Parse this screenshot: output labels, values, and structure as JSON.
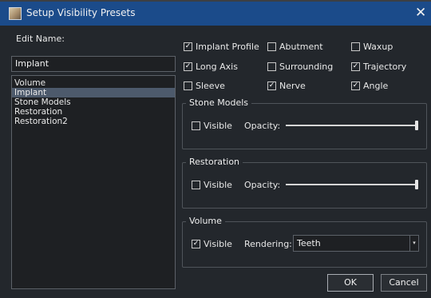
{
  "window": {
    "title": "Setup Visibility Presets"
  },
  "edit_name": {
    "label": "Edit Name:",
    "value": "Implant"
  },
  "presets": [
    "Volume",
    "Implant",
    "Stone Models",
    "Restoration",
    "Restoration2"
  ],
  "selected_preset": "Implant",
  "options": [
    {
      "label": "Implant Profile",
      "checked": true
    },
    {
      "label": "Abutment",
      "checked": false
    },
    {
      "label": "Waxup",
      "checked": false
    },
    {
      "label": "Long Axis",
      "checked": true
    },
    {
      "label": "Surrounding",
      "checked": false
    },
    {
      "label": "Trajectory",
      "checked": true
    },
    {
      "label": "Sleeve",
      "checked": false
    },
    {
      "label": "Nerve",
      "checked": true
    },
    {
      "label": "Angle",
      "checked": true
    }
  ],
  "stone_models": {
    "title": "Stone Models",
    "visible_label": "Visible",
    "visible_checked": false,
    "opacity_label": "Opacity:",
    "opacity": 1.0
  },
  "restoration": {
    "title": "Restoration",
    "visible_label": "Visible",
    "visible_checked": false,
    "opacity_label": "Opacity:",
    "opacity": 1.0
  },
  "volume": {
    "title": "Volume",
    "visible_label": "Visible",
    "visible_checked": true,
    "rendering_label": "Rendering:",
    "rendering_value": "Teeth"
  },
  "buttons": {
    "ok": "OK",
    "cancel": "Cancel"
  },
  "icons": {
    "app": "app-icon",
    "close": "close-icon",
    "check": "check-icon",
    "dropdown": "dropdown-arrow-icon"
  },
  "colors": {
    "titlebar": "#1b4b8a",
    "background": "#23272c",
    "selection": "#4d5a6c"
  }
}
